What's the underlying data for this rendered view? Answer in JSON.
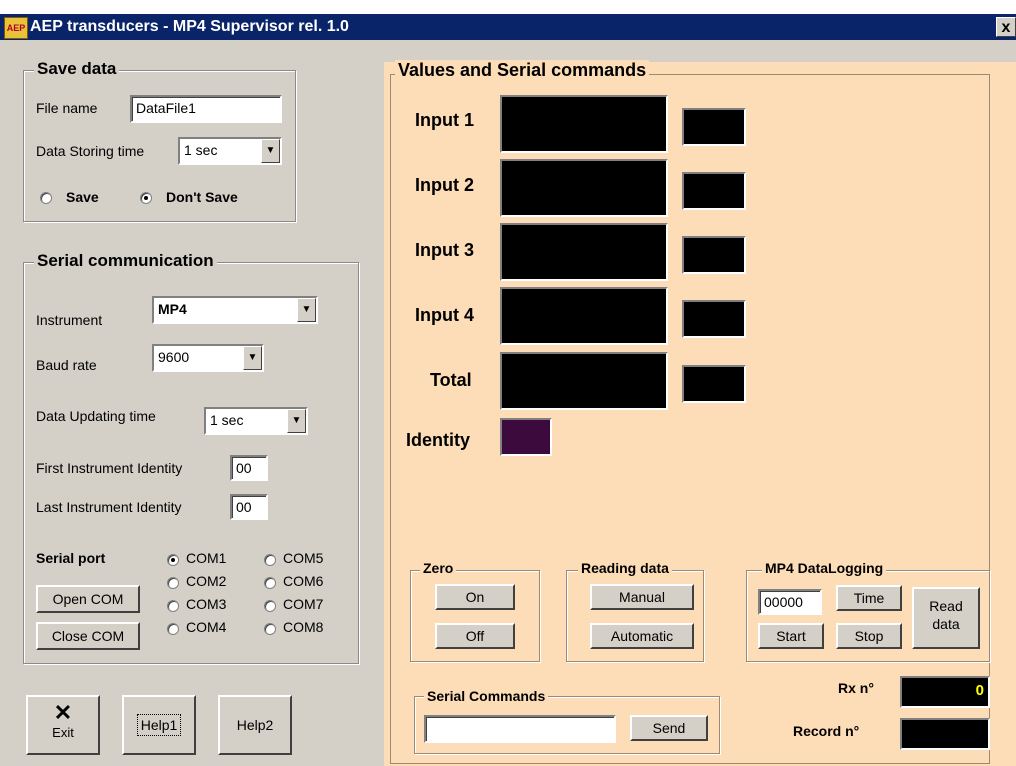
{
  "window": {
    "title": "AEP transducers - MP4 Supervisor rel. 1.0",
    "close_label": "x",
    "logo_text": "AEP"
  },
  "save_data": {
    "legend": "Save data",
    "file_name_label": "File name",
    "file_name_value": "DataFile1",
    "storing_time_label": "Data Storing time",
    "storing_time_value": "1 sec",
    "save_label": "Save",
    "dont_save_label": "Don't Save",
    "selected": "Don't Save"
  },
  "serial": {
    "legend": "Serial communication",
    "instrument_label": "Instrument",
    "instrument_value": "MP4",
    "baud_label": "Baud rate",
    "baud_value": "9600",
    "updating_label": "Data Updating time",
    "updating_value": "1 sec",
    "first_id_label": "First Instrument Identity",
    "first_id_value": "00",
    "last_id_label": "Last Instrument Identity",
    "last_id_value": "00",
    "port_label": "Serial port",
    "open_label": "Open COM",
    "close_label": "Close COM",
    "ports": [
      "COM1",
      "COM2",
      "COM3",
      "COM4",
      "COM5",
      "COM6",
      "COM7",
      "COM8"
    ],
    "selected_port": "COM1"
  },
  "bottom_buttons": {
    "exit": "Exit",
    "help1": "Help1",
    "help2": "Help2"
  },
  "values": {
    "legend": "Values and Serial commands",
    "input1": "Input 1",
    "input2": "Input 2",
    "input3": "Input 3",
    "input4": "Input 4",
    "total": "Total",
    "identity": "Identity"
  },
  "zero": {
    "legend": "Zero",
    "on": "On",
    "off": "Off"
  },
  "reading": {
    "legend": "Reading data",
    "manual": "Manual",
    "automatic": "Automatic"
  },
  "datalogging": {
    "legend": "MP4 DataLogging",
    "counter": "00000",
    "time": "Time",
    "start": "Start",
    "stop": "Stop",
    "read": "Read data"
  },
  "commands": {
    "legend": "Serial Commands",
    "input_value": "",
    "send": "Send"
  },
  "counters": {
    "rx_label": "Rx n°",
    "rx_value": "0",
    "record_label": "Record n°",
    "record_value": ""
  },
  "colors": {
    "panel": "#d4d0c8",
    "values_bg": "#fddcb8",
    "titlebar": "#0a246a",
    "identity_box": "#3c0a3c",
    "rx_text": "#ffff00"
  }
}
